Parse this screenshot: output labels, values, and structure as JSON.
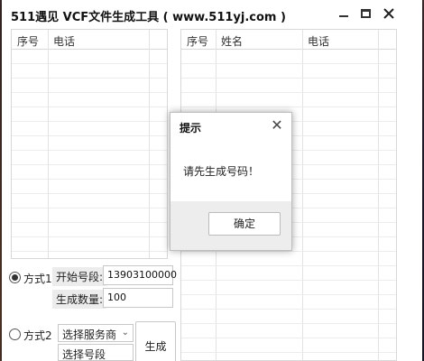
{
  "window": {
    "title": "511遇见 VCF文件生成工具 ( www.511yj.com )"
  },
  "left_table": {
    "headers": [
      "序号",
      "电话"
    ]
  },
  "right_table": {
    "headers": [
      "序号",
      "姓名",
      "电话"
    ]
  },
  "mode1": {
    "label": "方式1",
    "checked": true,
    "start_label": "开始号段:",
    "start_value": "13903100000",
    "count_label": "生成数量:",
    "count_value": "100"
  },
  "mode2": {
    "label": "方式2",
    "checked": false,
    "carrier_select": "选择服务商",
    "second_select": "选择号段"
  },
  "generate_button": "生成",
  "dialog": {
    "title": "提示",
    "message": "请先生成号码！",
    "ok_label": "确定"
  },
  "icons": {
    "close": "close-icon",
    "minimize": "minimize-icon",
    "maximize": "maximize-icon",
    "chevron": "chevron-down-icon"
  }
}
